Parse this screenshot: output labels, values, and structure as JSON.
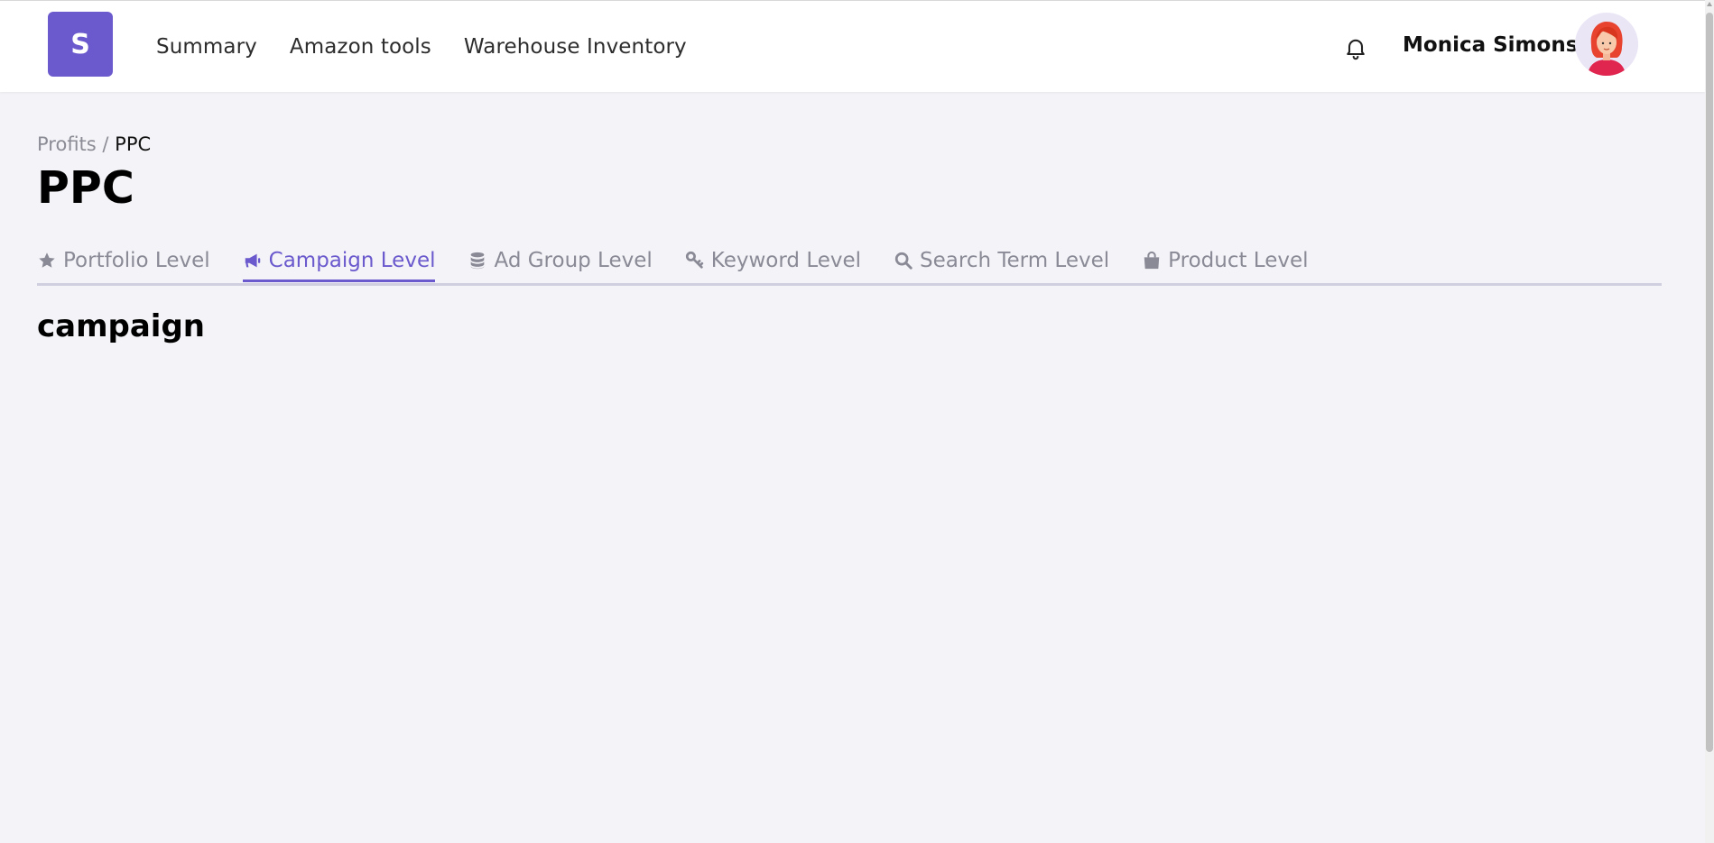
{
  "header": {
    "logo_letter": "S",
    "nav": [
      {
        "label": "Summary"
      },
      {
        "label": "Amazon tools"
      },
      {
        "label": "Warehouse Inventory"
      }
    ],
    "user_name": "Monica Simons"
  },
  "breadcrumb": {
    "parent": "Profits",
    "separator": " / ",
    "current": "PPC"
  },
  "page_title": "PPC",
  "tabs": [
    {
      "label": "Portfolio Level",
      "icon": "star-icon"
    },
    {
      "label": "Campaign Level",
      "icon": "megaphone-icon",
      "active": true
    },
    {
      "label": "Ad Group Level",
      "icon": "database-icon"
    },
    {
      "label": "Keyword Level",
      "icon": "key-icon"
    },
    {
      "label": "Search Term Level",
      "icon": "search-icon"
    },
    {
      "label": "Product Level",
      "icon": "shopping-bag-icon"
    }
  ],
  "section_heading": "campaign",
  "colors": {
    "accent": "#6a5acd",
    "background": "#f4f4f8",
    "tab_inactive": "#8a8a97"
  }
}
